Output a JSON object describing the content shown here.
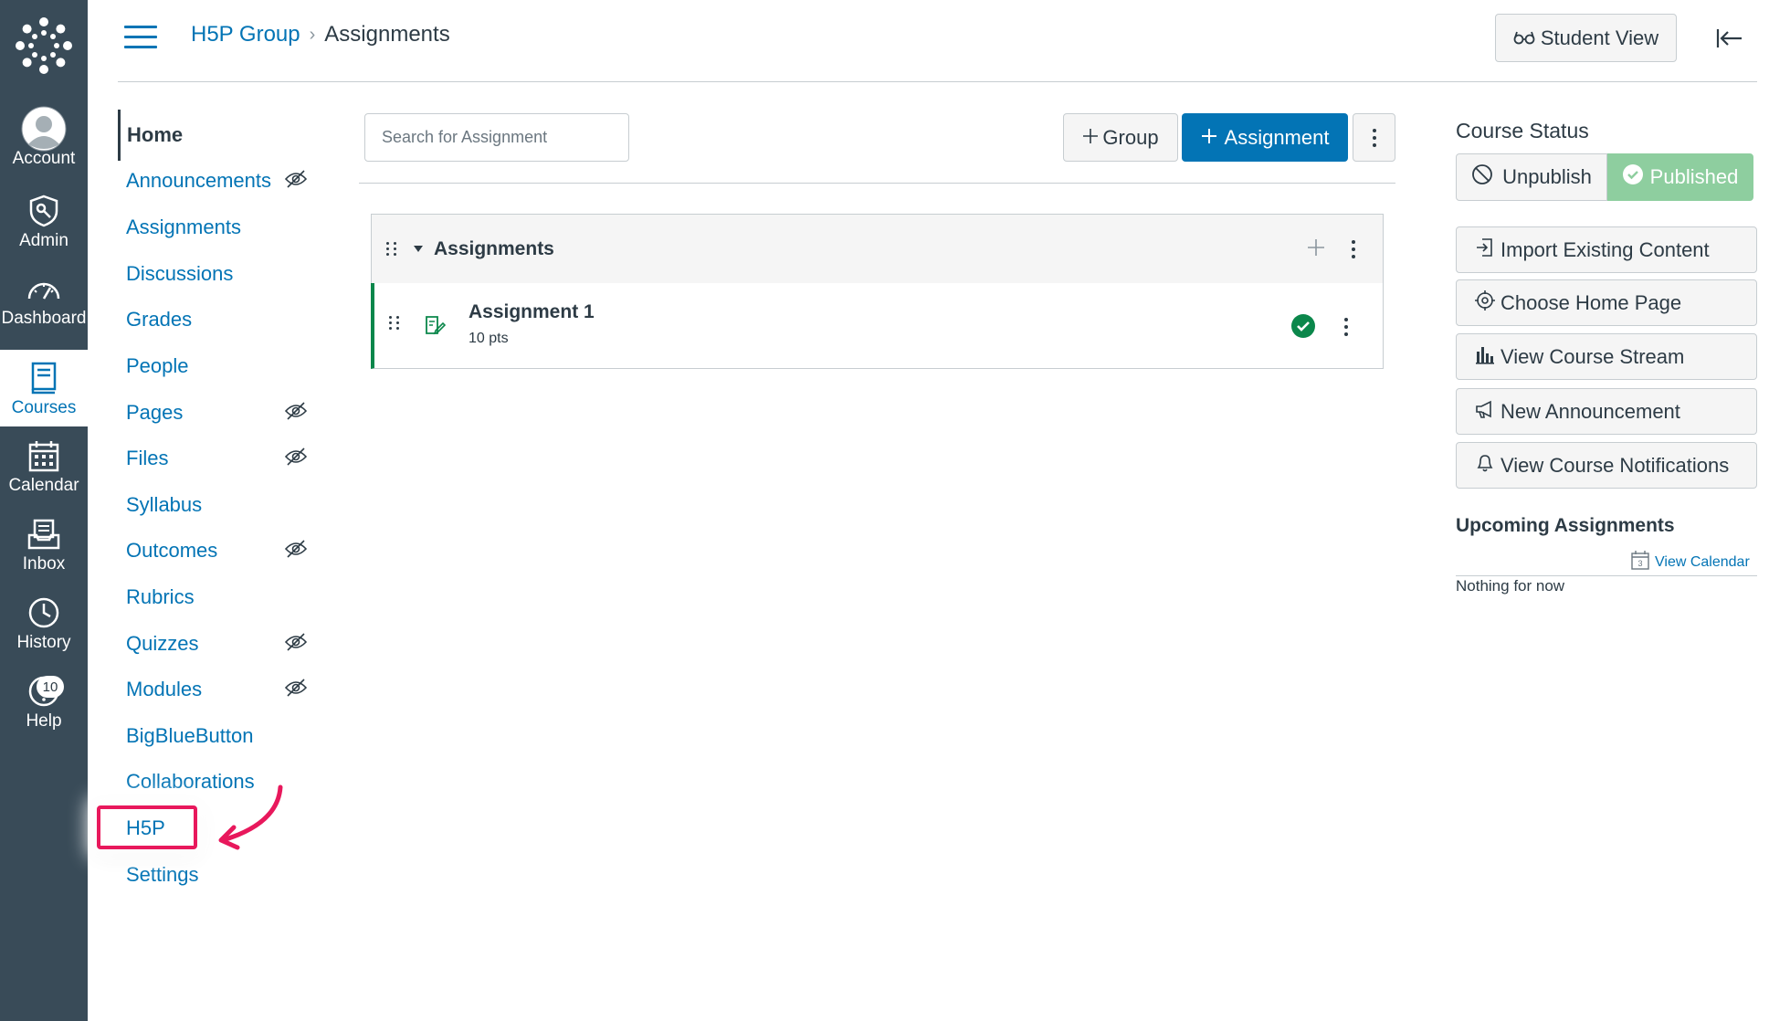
{
  "global_nav": {
    "items": [
      {
        "label": "Account",
        "icon": "account-icon"
      },
      {
        "label": "Admin",
        "icon": "admin-icon"
      },
      {
        "label": "Dashboard",
        "icon": "dashboard-icon"
      },
      {
        "label": "Courses",
        "icon": "courses-icon",
        "active": true
      },
      {
        "label": "Calendar",
        "icon": "calendar-icon"
      },
      {
        "label": "Inbox",
        "icon": "inbox-icon"
      },
      {
        "label": "History",
        "icon": "history-icon"
      },
      {
        "label": "Help",
        "icon": "help-icon",
        "badge": "10"
      }
    ]
  },
  "header": {
    "breadcrumb_course": "H5P Group",
    "breadcrumb_sep": "›",
    "breadcrumb_current": "Assignments",
    "student_view_label": "Student View"
  },
  "course_nav": {
    "items": [
      {
        "label": "Home",
        "active": true,
        "hidden": false
      },
      {
        "label": "Announcements",
        "hidden": true
      },
      {
        "label": "Assignments",
        "hidden": false
      },
      {
        "label": "Discussions",
        "hidden": false
      },
      {
        "label": "Grades",
        "hidden": false
      },
      {
        "label": "People",
        "hidden": false
      },
      {
        "label": "Pages",
        "hidden": true
      },
      {
        "label": "Files",
        "hidden": true
      },
      {
        "label": "Syllabus",
        "hidden": false
      },
      {
        "label": "Outcomes",
        "hidden": true
      },
      {
        "label": "Rubrics",
        "hidden": false
      },
      {
        "label": "Quizzes",
        "hidden": true
      },
      {
        "label": "Modules",
        "hidden": true
      },
      {
        "label": "BigBlueButton",
        "hidden": false
      },
      {
        "label": "Collaborations",
        "hidden": false
      },
      {
        "label": "H5P",
        "hidden": false,
        "highlighted": true
      },
      {
        "label": "Settings",
        "hidden": false
      }
    ]
  },
  "toolbar": {
    "search_placeholder": "Search for Assignment",
    "group_label": "Group",
    "assignment_label": "Assignment"
  },
  "assignment_group": {
    "title": "Assignments",
    "items": [
      {
        "title": "Assignment 1",
        "points": "10 pts",
        "published": true
      }
    ]
  },
  "sidebar": {
    "course_status_title": "Course Status",
    "unpublish_label": "Unpublish",
    "published_label": "Published",
    "buttons": [
      {
        "label": "Import Existing Content",
        "icon": "import-icon"
      },
      {
        "label": "Choose Home Page",
        "icon": "target-icon"
      },
      {
        "label": "View Course Stream",
        "icon": "bar-chart-icon"
      },
      {
        "label": "New Announcement",
        "icon": "megaphone-icon"
      },
      {
        "label": "View Course Notifications",
        "icon": "bell-icon"
      }
    ],
    "upcoming_title": "Upcoming Assignments",
    "view_calendar": "View Calendar",
    "calendar_day": "3",
    "nothing_text": "Nothing for now"
  },
  "colors": {
    "nav_bg": "#394b58",
    "link": "#0374b5",
    "published": "#8ece9f",
    "success": "#0b874b",
    "annotation": "#e8185c"
  }
}
